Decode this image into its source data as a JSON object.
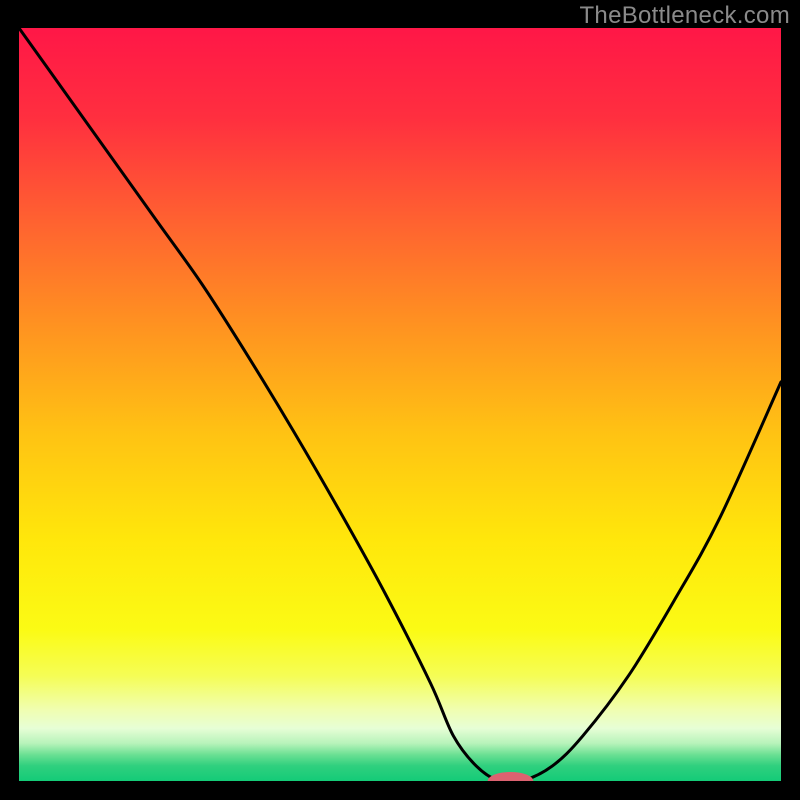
{
  "watermark": "TheBottleneck.com",
  "chart_data": {
    "type": "line",
    "title": "",
    "xlabel": "",
    "ylabel": "",
    "xlim": [
      0,
      1
    ],
    "ylim": [
      0,
      1
    ],
    "x": [
      0.0,
      0.06,
      0.12,
      0.18,
      0.24,
      0.3,
      0.36,
      0.42,
      0.48,
      0.54,
      0.57,
      0.6,
      0.63,
      0.66,
      0.7,
      0.74,
      0.8,
      0.86,
      0.92,
      1.0
    ],
    "values": [
      1.0,
      0.915,
      0.83,
      0.745,
      0.66,
      0.565,
      0.465,
      0.36,
      0.25,
      0.13,
      0.06,
      0.02,
      0.0,
      0.0,
      0.02,
      0.06,
      0.14,
      0.24,
      0.35,
      0.53
    ],
    "marker": {
      "x": 0.645,
      "y": 0.0,
      "rx": 0.03,
      "ry": 0.012
    },
    "gradient": {
      "stops": [
        {
          "offset": 0.0,
          "color": "#ff1747"
        },
        {
          "offset": 0.12,
          "color": "#ff2f3f"
        },
        {
          "offset": 0.26,
          "color": "#ff6330"
        },
        {
          "offset": 0.4,
          "color": "#ff9420"
        },
        {
          "offset": 0.54,
          "color": "#ffc313"
        },
        {
          "offset": 0.68,
          "color": "#ffe70b"
        },
        {
          "offset": 0.8,
          "color": "#fbfb15"
        },
        {
          "offset": 0.86,
          "color": "#f5fd55"
        },
        {
          "offset": 0.905,
          "color": "#f0feb0"
        },
        {
          "offset": 0.93,
          "color": "#e7fed6"
        },
        {
          "offset": 0.95,
          "color": "#b7f3ba"
        },
        {
          "offset": 0.965,
          "color": "#6be093"
        },
        {
          "offset": 0.98,
          "color": "#2fd07e"
        },
        {
          "offset": 1.0,
          "color": "#14cb78"
        }
      ]
    },
    "marker_fill": "#dc6270",
    "curve_stroke": "#000000",
    "curve_width": 3
  }
}
